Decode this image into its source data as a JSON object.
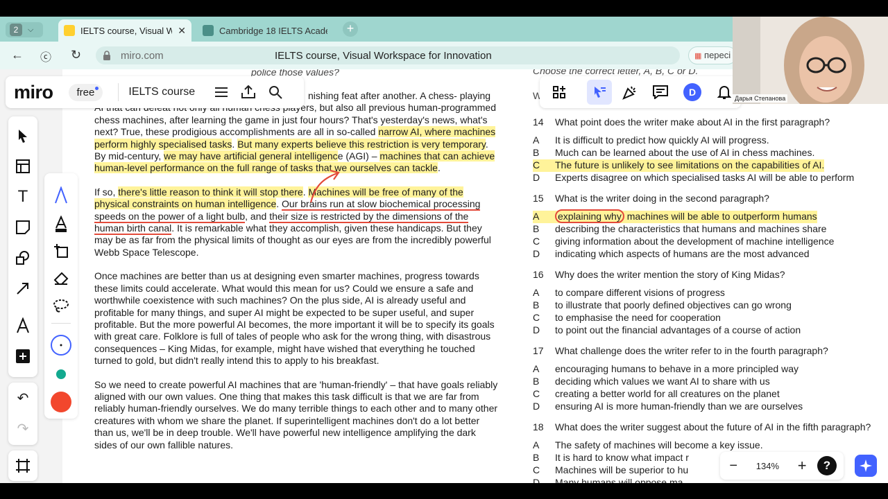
{
  "browser": {
    "tab_count": "2",
    "tabs": [
      {
        "title": "IELTS course, Visual Wor"
      },
      {
        "title": "Cambridge 18 IELTS Acade"
      }
    ],
    "url": "miro.com",
    "page_title": "IELTS course, Visual Workspace for Innovation",
    "translate_label": "пересі"
  },
  "miro": {
    "logo": "miro",
    "plan": "free",
    "board_name": "IELTS course",
    "avatar_letter": "D",
    "zoom": "134%",
    "help": "?"
  },
  "webcam": {
    "name": "Дарья Степанова"
  },
  "passage": {
    "top_partial": "police those values?",
    "p1": {
      "s1": "nishing feat after another. A chess-",
      "s2": "playing AI that can defeat not only all human chess players, but also all previous human-programmed chess machines, after learning the game in just four hours? That's yesterday's news, what's next? True, these prodigious accomplishments are all in so-called ",
      "h1": "narrow AI, where machines perform highly specialised tasks",
      "s3": ". ",
      "h2": "But many experts believe this restriction is very temporary",
      "s4": ". By mid-century, ",
      "h3": "we may have artificial general intelligenc",
      "s5": "e (AGI) – ",
      "h4": "machines that can achieve human-level performance on the full range of tasks that we ourselves can tackle",
      "s6": "."
    },
    "p2": {
      "s1": "If so, ",
      "h1": "there's little reason to think it will stop there",
      "s2": ". ",
      "h2": "Machines will be free of many of the physical constraints on human intelligence",
      "s3": ". ",
      "u1": "Our brains run at slow biochemical processing speeds on the power of a light bulb",
      "s4": ", and ",
      "u2": "their size is restricted by the dimensions of the human birth canal",
      "s5": ". It is remarkable what they accomplish, given these handicaps. But they may be as far from the physical limits of thought as our eyes are from the incredibly powerful Webb Space Telescope."
    },
    "p3": "Once machines are better than us at designing even smarter machines, progress towards these limits could accelerate. What would this mean for us? Could we ensure a safe and worthwhile coexistence with such machines? On the plus side, AI is already useful and profitable for many things, and super AI might be expected to be super useful, and super profitable. But the more powerful AI becomes, the more important it will be to specify its goals with great care. Folklore is full of tales of people who ask for the wrong thing, with disastrous consequences – King Midas, for example, might have wished that everything he touched turned to gold, but didn't really intend this to apply to his breakfast.",
    "p4": "So we need to create powerful AI machines that are 'human-friendly' – that have goals reliably aligned with our own values. One thing that makes this task difficult is that we are far from reliably human-friendly ourselves. We do many terrible things to each other and to many other creatures with whom we share the planet. If superintelligent machines don't do a lot better than us, we'll be in deep trouble. We'll have powerful new intelligence amplifying the dark sides of our own fallible natures."
  },
  "questions": {
    "instruction": "Choose the correct letter, A, B, C or D.",
    "write_partial": "W",
    "q14": {
      "num": "14",
      "text": "What point does the writer make about AI in the first paragraph?",
      "A": "It is difficult to predict how quickly AI will progress.",
      "B": "Much can be learned about the use of AI in chess machines.",
      "C": "The future is unlikely to see limitations on the capabilities of AI.",
      "D": "Experts disagree on which specialised tasks AI will be able to perform"
    },
    "q15": {
      "num": "15",
      "text": "What is the writer doing in the second paragraph?",
      "A_circle": "explaining why",
      "A_rest": " machines will be able to outperform humans",
      "B": "describing the characteristics that humans and machines share",
      "C": "giving information about the development of machine intelligence",
      "D": "indicating which aspects of humans are the most advanced"
    },
    "q16": {
      "num": "16",
      "text": "Why does the writer mention the story of King Midas?",
      "A": "to compare different visions of progress",
      "B": "to illustrate that poorly defined objectives can go wrong",
      "C": "to emphasise the need for cooperation",
      "D": "to point out the financial advantages of a course of action"
    },
    "q17": {
      "num": "17",
      "text": "What challenge does the writer refer to in the fourth paragraph?",
      "A": "encouraging humans to behave in a more principled way",
      "B": "deciding which values we want AI to share with us",
      "C": "creating a better world for all creatures on the planet",
      "D": "ensuring AI is more human-friendly than we are ourselves"
    },
    "q18": {
      "num": "18",
      "text": "What does the writer suggest about the future of AI in the fifth paragraph?",
      "A": "The safety of machines will become a key issue.",
      "B": "It is hard to know what impact r",
      "C": "Machines will be superior to hu",
      "D": "Many humans will oppose ma"
    },
    "letters": {
      "A": "A",
      "B": "B",
      "C": "C",
      "D": "D"
    }
  },
  "colors": {
    "miro_blue": "#4262ff",
    "pen_red": "#e34a3a",
    "highlight": "#ffec64",
    "tab_teal": "#9fd6cf",
    "swatch_green": "#13a98f",
    "swatch_orange": "#f2472d"
  }
}
